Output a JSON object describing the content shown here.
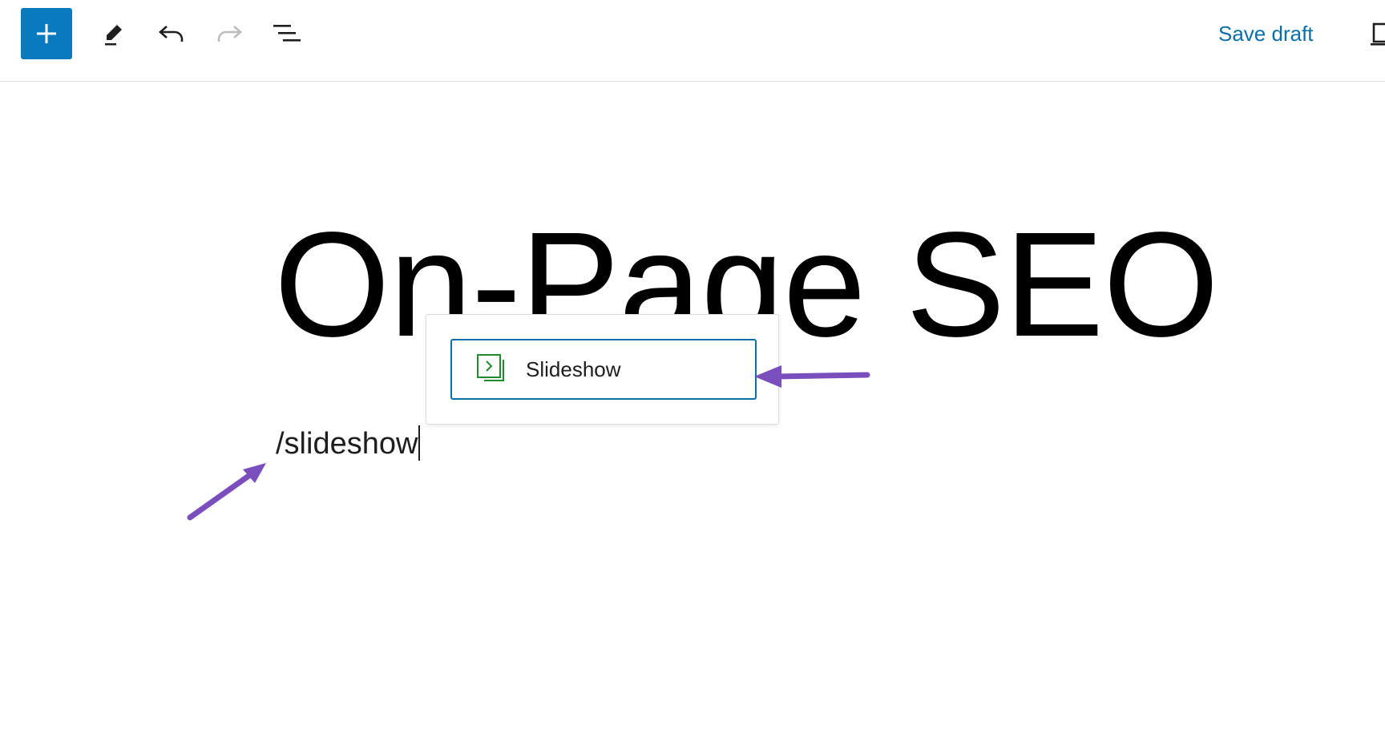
{
  "toolbar": {
    "add_block_icon": "plus-icon",
    "tools_icon": "pencil-icon",
    "undo_icon": "undo-icon",
    "redo_icon": "redo-icon",
    "outline_icon": "list-view-icon",
    "save_draft_label": "Save draft",
    "preview_icon": "preview-device-icon",
    "accent_color": "#0a7abf"
  },
  "editor": {
    "post_title": "On-Page SEO",
    "paragraph_text": "/slideshow"
  },
  "autocomplete": {
    "options": [
      {
        "label": "Slideshow",
        "icon": "slideshow-icon",
        "icon_color": "#1f8b2c",
        "selected": true
      }
    ]
  },
  "annotations": {
    "arrow_color": "#7a4fbd"
  }
}
